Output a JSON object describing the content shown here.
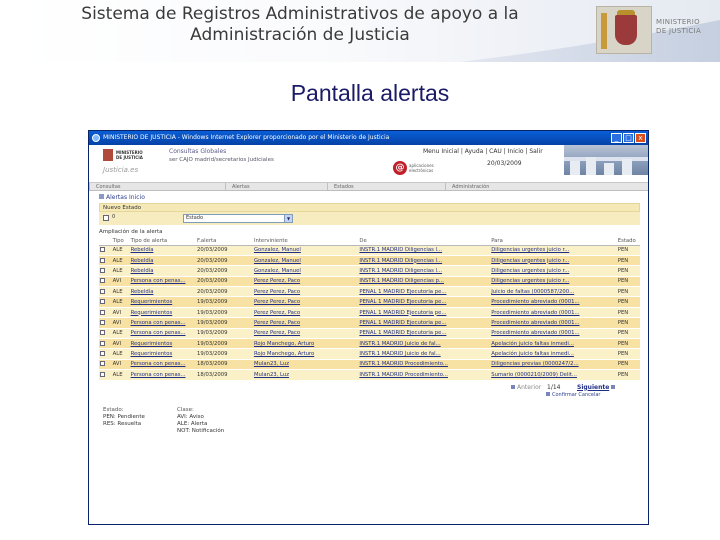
{
  "slide": {
    "title_line1": "Sistema de Registros Administrativos de apoyo a la",
    "title_line2": "Administración de Justicia",
    "subtitle": "Pantalla alertas",
    "logo_text_line1": "MINISTERIO",
    "logo_text_line2": "DE JUSTICIA"
  },
  "window": {
    "title": "MINISTERIO DE JUSTICIA - Windows Internet Explorer proporcionado por el Ministerio de Justicia",
    "minimize": "_",
    "maximize": "□",
    "close": "x"
  },
  "app": {
    "logo_line1": "MINISTERIO",
    "logo_line2": "DE JUSTICIA",
    "site_name": "Justicia.es",
    "module_title": "Consultas Globales",
    "user_line": "ser CAJO madrid/secretarios Judiciales",
    "nav_text": "Menu Inicial | Ayuda | CAU | Inicio | Salir",
    "date": "20/03/2009",
    "brand_line1": "aplicaciones",
    "brand_line2": "electrónicas",
    "tabs": [
      "Consultas",
      "Alertas",
      "Estados",
      "Administración"
    ]
  },
  "content": {
    "breadcrumb": "Alertas   Inicio",
    "nuevo_estado_label": "Nuevo Estado",
    "estado_code": "0",
    "estado_option": "Estado",
    "ampliacion_label": "Ampliación de la alerta",
    "columns": [
      "",
      "Tipo",
      "Tipo de alerta",
      "F.alerta",
      "Interviniente",
      "De",
      "Para",
      "Estado"
    ],
    "rows": [
      [
        "ALE",
        "Rebeldía",
        "20/03/2009",
        "Gonzalez, Manuel",
        "INSTR.1 MADRID Diligencias l...",
        "Diligencias urgentes juicio r...",
        "PEN"
      ],
      [
        "ALE",
        "Rebeldía",
        "20/03/2009",
        "Gonzalez, Manuel",
        "INSTR.1 MADRID Diligencias l...",
        "Diligencias urgentes juicio r...",
        "PEN"
      ],
      [
        "ALE",
        "Rebeldía",
        "20/03/2009",
        "Gonzalez, Manuel",
        "INSTR.1 MADRID Diligencias l...",
        "Diligencias urgentes juicio r...",
        "PEN"
      ],
      [
        "AVI",
        "Persona con penas...",
        "20/03/2009",
        "Perez Perez, Paco",
        "INSTR.1 MADRID Diligencias p...",
        "Diligencias urgentes juicio r...",
        "PEN"
      ],
      [
        "ALE",
        "Rebeldía",
        "20/03/2009",
        "Perez Perez, Paco",
        "PENAL 1 MADRID Ejecutoria pe...",
        "Juicio de faltas (0000587/200...",
        "PEN"
      ],
      [
        "ALE",
        "Requerimientos",
        "19/03/2009",
        "Perez Perez, Paco",
        "PENAL 1 MADRID Ejecutoria pe...",
        "Procedimiento abreviado (0001...",
        "PEN"
      ],
      [
        "AVI",
        "Requerimientos",
        "19/03/2009",
        "Perez Perez, Paco",
        "PENAL 1 MADRID Ejecutoria pe...",
        "Procedimiento abreviado (0001...",
        "PEN"
      ],
      [
        "AVI",
        "Persona con penas...",
        "19/03/2009",
        "Perez Perez, Paco",
        "PENAL 1 MADRID Ejecutoria pe...",
        "Procedimiento abreviado (0001...",
        "PEN"
      ],
      [
        "ALE",
        "Persona con penas...",
        "19/03/2009",
        "Perez Perez, Paco",
        "PENAL 1 MADRID Ejecutoria pe...",
        "Procedimiento abreviado (0001...",
        "PEN"
      ],
      [
        "AVI",
        "Requerimientos",
        "19/03/2009",
        "Rojo Manchego, Arturo",
        "INSTR.1 MADRID Juicio de fal...",
        "Apelación juicio faltas inmedi...",
        "PEN"
      ],
      [
        "ALE",
        "Requerimientos",
        "19/03/2009",
        "Rojo Manchego, Arturo",
        "INSTR.1 MADRID Juicio de fal...",
        "Apelación juicio faltas inmedi...",
        "PEN"
      ],
      [
        "AVI",
        "Persona con penas...",
        "18/03/2009",
        "Mulan23, Luz",
        "INSTR.1 MADRID Procedimiento...",
        "Diligencias previas (0000247/2...",
        "PEN"
      ],
      [
        "ALE",
        "Persona con penas...",
        "18/03/2009",
        "Mulan23, Luz",
        "INSTR.1 MADRID Procedimiento...",
        "Sumario (0000210/2009) Delit...",
        "PEN"
      ]
    ],
    "pager_prev": "Anterior",
    "pager_pages": "1/14",
    "pager_next": "Siguiente",
    "pager_actions": "Confirmar   Cancelar",
    "legend_estado_title": "Estado:",
    "legend_estado_items": [
      "PEN: Pendiente",
      "RES: Resuelta"
    ],
    "legend_clase_title": "Clase:",
    "legend_clase_items": [
      "AVI: Aviso",
      "ALE: Alerta",
      "NOT: Notificación"
    ]
  },
  "colors": {
    "title_bar": "#0a5ed6",
    "row_light": "#fbf1c8",
    "row_dark": "#f7e2a3",
    "link": "#1f2e86",
    "subtitle": "#1a1a66"
  }
}
